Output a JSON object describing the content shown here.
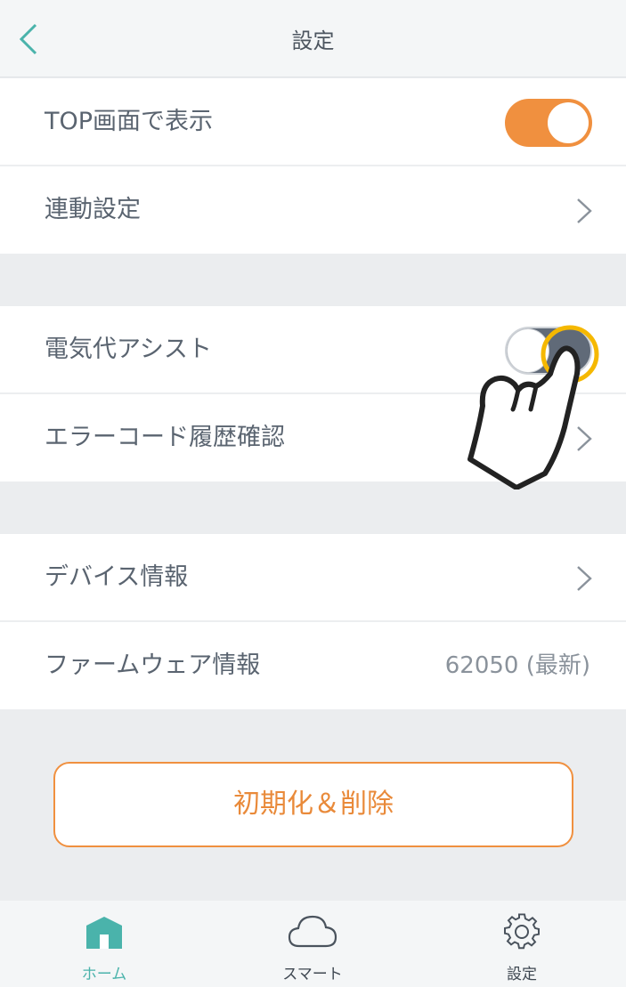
{
  "header": {
    "title": "設定"
  },
  "group1": {
    "top_display_label": "TOP画面で表示",
    "top_display_on": true,
    "link_settings_label": "連動設定"
  },
  "group2": {
    "electric_assist_label": "電気代アシスト",
    "electric_assist_on": false,
    "error_history_label": "エラーコード履歴確認"
  },
  "group3": {
    "device_info_label": "デバイス情報",
    "firmware_label": "ファームウェア情報",
    "firmware_value": "62050 (最新)"
  },
  "reset_button_label": "初期化＆削除",
  "tabbar": {
    "home_label": "ホーム",
    "smart_label": "スマート",
    "settings_label": "設定"
  },
  "colors": {
    "accent": "#f0903f",
    "teal": "#4ab3ab",
    "highlight": "#f5b800"
  },
  "icons": [
    "back-chevron-icon",
    "chevron-right-icon",
    "home-icon",
    "cloud-icon",
    "gear-icon",
    "tap-hand-icon"
  ]
}
